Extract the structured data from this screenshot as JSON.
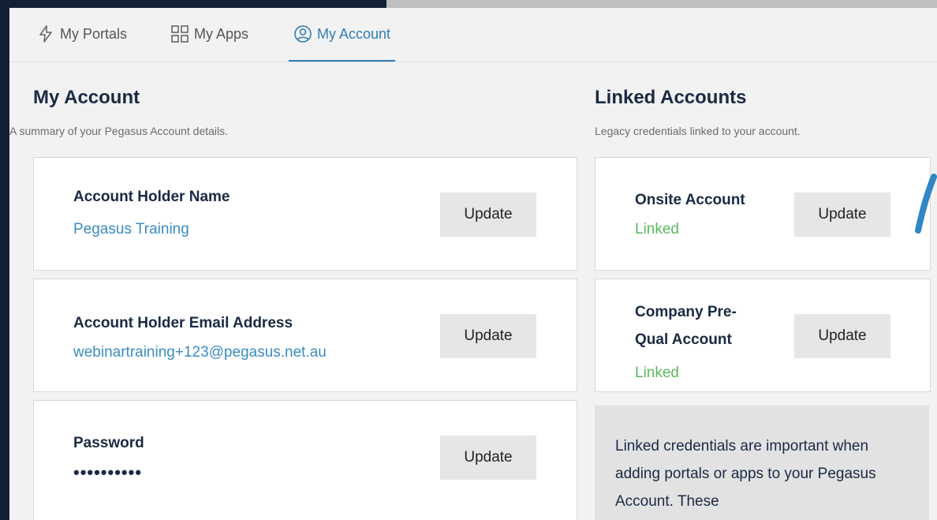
{
  "nav": {
    "tabs": [
      {
        "label": "My Portals",
        "icon": "lightning-icon"
      },
      {
        "label": "My Apps",
        "icon": "grid-icon"
      },
      {
        "label": "My Account",
        "icon": "user-circle-icon",
        "active": true
      }
    ]
  },
  "account": {
    "title": "My Account",
    "subtitle": "A summary of your Pegasus Account details.",
    "cards": [
      {
        "label": "Account Holder Name",
        "value": "Pegasus Training",
        "button": "Update"
      },
      {
        "label": "Account Holder Email Address",
        "value": "webinartraining+123@pegasus.net.au",
        "button": "Update"
      },
      {
        "label": "Password",
        "value": "••••••••••",
        "button": "Update"
      }
    ]
  },
  "linked": {
    "title": "Linked Accounts",
    "subtitle": "Legacy credentials linked to your account.",
    "cards": [
      {
        "label": "Onsite Account",
        "status": "Linked",
        "button": "Update"
      },
      {
        "label_line1": "Company Pre-",
        "label_line2": "Qual Account",
        "status": "Linked",
        "button": "Update"
      }
    ],
    "note": "Linked credentials are important when adding portals or apps to your Pegasus Account. These"
  },
  "colors": {
    "accent": "#2f7fb5",
    "linked": "#5cb85c",
    "frame": "#132035"
  }
}
